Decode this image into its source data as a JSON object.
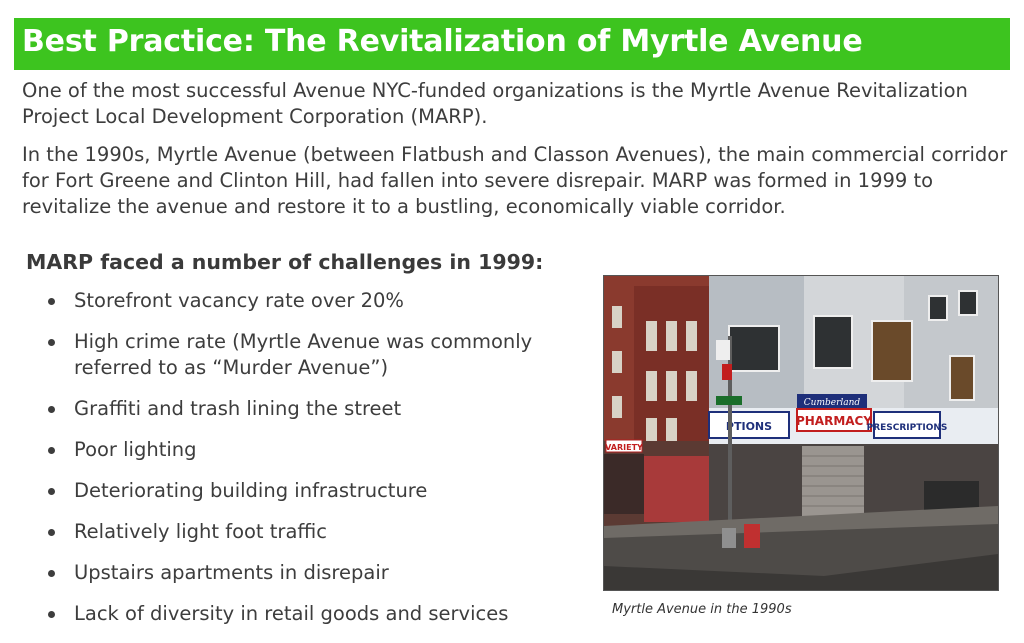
{
  "title": "Best Practice: The Revitalization of Myrtle Avenue",
  "intro_paragraphs": [
    "One of the most successful Avenue NYC-funded organizations is the Myrtle Avenue Revitalization Project Local Development Corporation (MARP).",
    "In the 1990s, Myrtle Avenue (between Flatbush and Classon Avenues), the main commercial corridor for Fort Greene and Clinton Hill, had fallen into severe disrepair. MARP was formed in 1999 to revitalize the avenue and restore it to a bustling, economically viable corridor."
  ],
  "challenges": {
    "heading": "MARP faced a number of challenges in 1999:",
    "items": [
      "Storefront vacancy rate over 20%",
      "High crime rate (Myrtle Avenue was commonly referred to as “Murder Avenue”)",
      "Graffiti and trash lining the street",
      "Poor lighting",
      "Deteriorating building infrastructure",
      "Relatively light foot traffic",
      "Upstairs apartments in disrepair",
      "Lack of diversity in retail goods and services"
    ]
  },
  "photo": {
    "signs": {
      "cumberland": "Cumberland",
      "pharmacy": "PHARMACY",
      "prescriptions_left": "PTIONS",
      "prescriptions_right": "PRESCRIPTIONS",
      "variety": "VARIETY"
    }
  },
  "caption": "Myrtle Avenue in the 1990s",
  "colors": {
    "title_bar": "#3dc41f",
    "title_text": "#ffffff",
    "body_text": "#3d3d3d"
  }
}
